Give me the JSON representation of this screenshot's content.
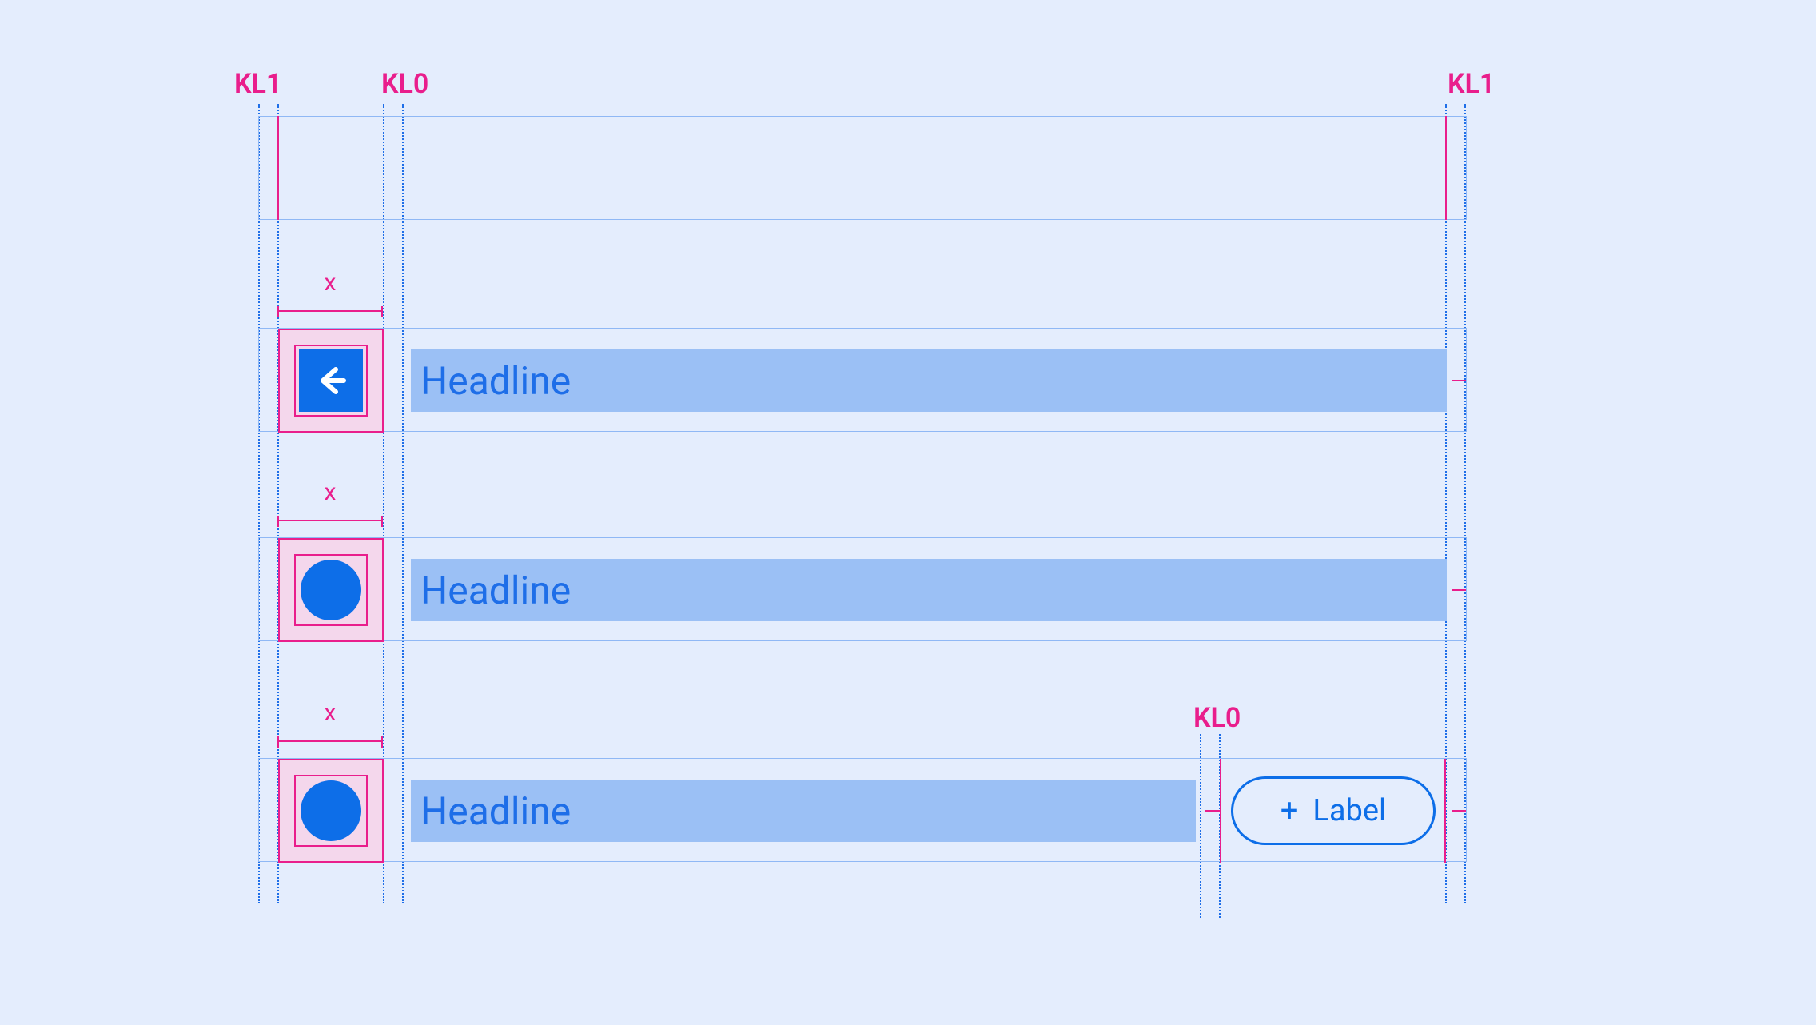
{
  "keylines": {
    "left_outer": "KL1",
    "left_inner": "KL0",
    "right_outer": "KL1",
    "right_inner_chip": "KL0"
  },
  "dimensions": {
    "icon_width_label": "x"
  },
  "rows": [
    {
      "headline": "Headline"
    },
    {
      "headline": "Headline"
    },
    {
      "headline": "Headline"
    }
  ],
  "chip": {
    "icon": "+",
    "label": "Label"
  },
  "colors": {
    "bg": "#e4edfd",
    "primary": "#0d6ee8",
    "headline_fill": "#9bc0f5",
    "keyline_pink": "#e91e8c",
    "icon_bg_pink": "#f4d7ec"
  }
}
